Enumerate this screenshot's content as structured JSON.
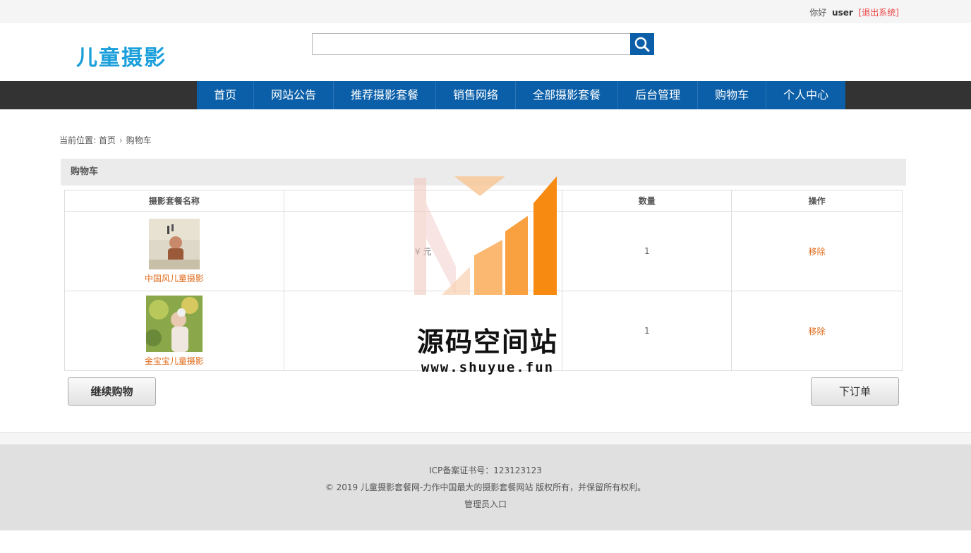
{
  "topbar": {
    "greeting": "你好",
    "username": "user",
    "logout": "[退出系统]"
  },
  "header": {
    "logo": "儿童摄影",
    "search": {
      "placeholder": "",
      "value": "",
      "icon": "search-icon"
    }
  },
  "nav": {
    "items": [
      "首页",
      "网站公告",
      "推荐摄影套餐",
      "销售网络",
      "全部摄影套餐",
      "后台管理",
      "购物车",
      "个人中心"
    ]
  },
  "breadcrumb": {
    "prefix": "当前位置:",
    "home": "首页",
    "current": "购物车"
  },
  "cart": {
    "title": "购物车",
    "columns": [
      "摄影套餐名称",
      "",
      "数量",
      "操作"
    ],
    "rows": [
      {
        "name": "中国风儿童摄影",
        "price": "¥  元",
        "qty": "1",
        "action": "移除"
      },
      {
        "name": "金宝宝儿童摄影",
        "price": "",
        "qty": "1",
        "action": "移除"
      }
    ]
  },
  "buttons": {
    "continue": "继续购物",
    "order": "下订单"
  },
  "footer": {
    "icp": "ICP备案证书号：123123123",
    "copyright": "© 2019 儿童摄影套餐网-力作中国最大的摄影套餐网站 版权所有，并保留所有权利。",
    "admin": "管理员入口"
  },
  "watermark": {
    "title": "源码空间站",
    "url": "www.shuyue.fun"
  },
  "colors": {
    "brand_blue": "#0a5fa8",
    "logo_blue": "#1a9fdb",
    "link_orange": "#e06a1a",
    "nav_dark": "#333333"
  }
}
